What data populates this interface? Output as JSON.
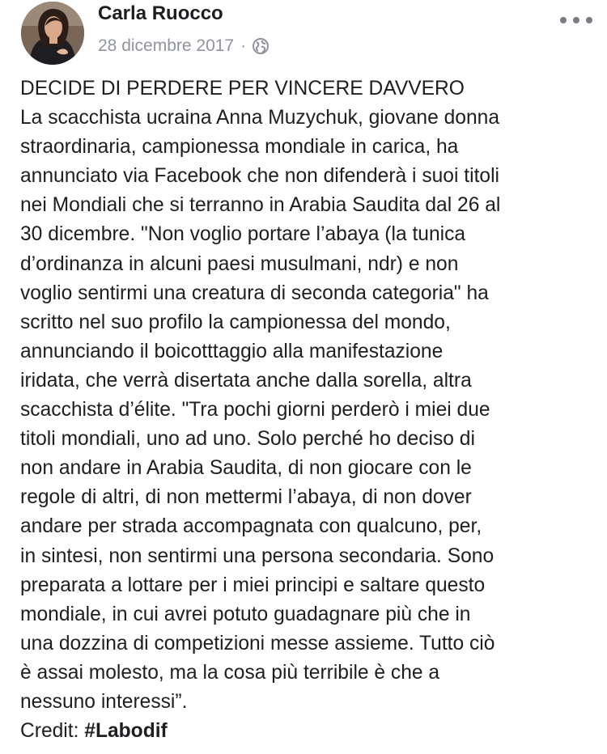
{
  "post": {
    "author_name": "Carla Ruocco",
    "date": "28 dicembre 2017",
    "separator": "·",
    "privacy_icon": "globe-icon",
    "more_icon": "more-options-icon",
    "lines": [
      "DECIDE DI PERDERE PER VINCERE DAVVERO",
      "La scacchista ucraina Anna Muzychuk, giovane donna",
      "straordinaria, campionessa mondiale in carica, ha",
      "annunciato via Facebook che non difenderà i suoi titoli",
      "nei Mondiali che si terranno in Arabia Saudita dal 26 al",
      "30 dicembre. \"Non voglio portare l’abaya (la tunica",
      "d’ordinanza in alcuni paesi musulmani, ndr) e non",
      "voglio sentirmi una creatura di seconda categoria\" ha",
      "scritto nel suo profilo la campionessa del mondo,",
      "annunciando il boicotttaggio alla manifestazione",
      "iridata, che verrà disertata anche dalla sorella, altra",
      "scacchista d’élite. \"Tra pochi giorni perderò i miei due",
      "titoli mondiali, uno ad uno. Solo perché ho deciso di",
      "non andare in Arabia Saudita, di non giocare con le",
      "regole di altri, di non mettermi l’abaya, di non dover",
      "andare per strada accompagnata con qualcuno, per,",
      "in sintesi, non sentirmi una persona secondaria. Sono",
      "preparata a lottare per i miei principi e saltare questo",
      "mondiale, in cui avrei potuto guadagnare più che in",
      "una dozzina di competizioni messe assieme. Tutto ciò",
      "è assai molesto, ma la cosa più terribile è che a",
      "nessuno interessi”."
    ],
    "credit_label": "Credit:",
    "credit_hashtag": "#Labodif"
  }
}
